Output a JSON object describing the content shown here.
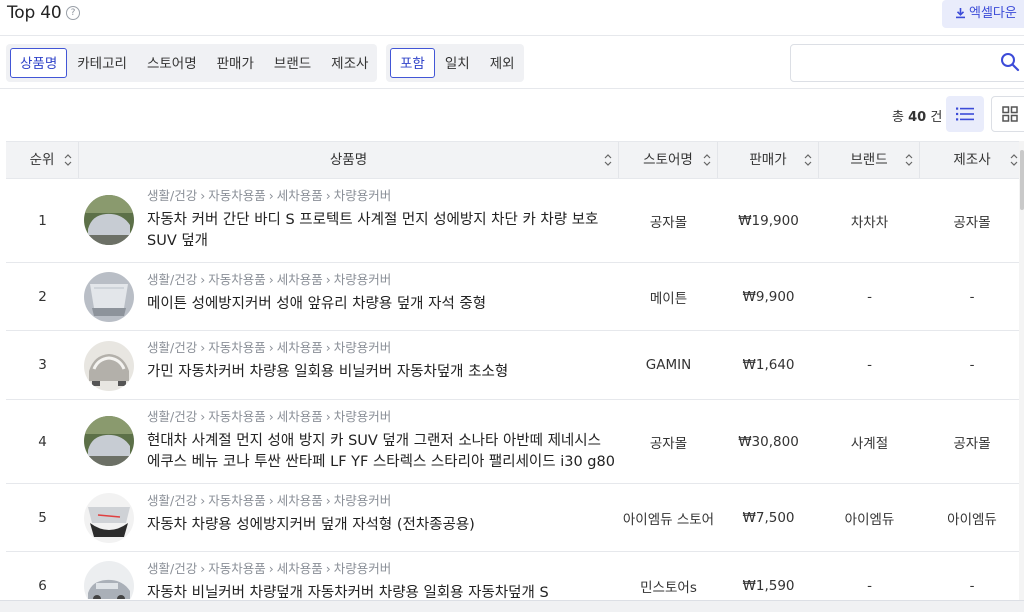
{
  "header": {
    "title": "Top 40",
    "help_glyph": "?",
    "excel_label": "엑셀다운"
  },
  "filters": {
    "field_tabs": [
      "상품명",
      "카테고리",
      "스토어명",
      "판매가",
      "브랜드",
      "제조사"
    ],
    "field_active": "상품명",
    "match_tabs": [
      "포함",
      "일치",
      "제외"
    ],
    "match_active": "포함",
    "search_value": "",
    "search_placeholder": ""
  },
  "summary": {
    "total_prefix": "총",
    "total_count": "40",
    "total_suffix": "건"
  },
  "table": {
    "columns": [
      "순위",
      "상품명",
      "스토어명",
      "판매가",
      "브랜드",
      "제조사"
    ],
    "rows": [
      {
        "rank": "1",
        "category": [
          "생활/건강",
          "자동차용품",
          "세차용품",
          "차량용커버"
        ],
        "name": "자동차 커버 간단 바디 S 프로텍트 사계절 먼지 성에방지 차단 카 차량 보호 SUV 덮개",
        "store": "공자몰",
        "price": "₩19,900",
        "brand": "차차차",
        "maker": "공자몰"
      },
      {
        "rank": "2",
        "category": [
          "생활/건강",
          "자동차용품",
          "세차용품",
          "차량용커버"
        ],
        "name": "메이튼 성에방지커버 성애 앞유리 차량용 덮개 자석 중형",
        "store": "메이튼",
        "price": "₩9,900",
        "brand": "-",
        "maker": "-"
      },
      {
        "rank": "3",
        "category": [
          "생활/건강",
          "자동차용품",
          "세차용품",
          "차량용커버"
        ],
        "name": "가민 자동차커버 차량용 일회용 비닐커버 자동차덮개 초소형",
        "store": "GAMIN",
        "price": "₩1,640",
        "brand": "-",
        "maker": "-"
      },
      {
        "rank": "4",
        "category": [
          "생활/건강",
          "자동차용품",
          "세차용품",
          "차량용커버"
        ],
        "name": "현대차 사계절 먼지 성애 방지 카 SUV 덮개 그랜저 소나타 아반떼 제네시스 에쿠스 베뉴 코나 투싼 싼타페 LF YF 스타렉스 스타리아 팰리세이드 i30 g80",
        "store": "공자몰",
        "price": "₩30,800",
        "brand": "사계절",
        "maker": "공자몰"
      },
      {
        "rank": "5",
        "category": [
          "생활/건강",
          "자동차용품",
          "세차용품",
          "차량용커버"
        ],
        "name": "자동차 차량용 성에방지커버 덮개 자석형 (전차종공용)",
        "store": "아이엠듀 스토어",
        "price": "₩7,500",
        "brand": "아이엠듀",
        "maker": "아이엠듀"
      },
      {
        "rank": "6",
        "category": [
          "생활/건강",
          "자동차용품",
          "세차용품",
          "차량용커버"
        ],
        "name": "자동차 비닐커버 차량덮개 자동차커버 차량용 일회용 자동차덮개 S",
        "store": "민스토어s",
        "price": "₩1,590",
        "brand": "-",
        "maker": "-"
      }
    ]
  },
  "colors": {
    "accent": "#3c4bd8",
    "accent_bg": "#e9ecfb",
    "header_bg": "#f2f3f5",
    "border": "#e6e8ec",
    "muted_text": "#8b9098"
  },
  "icons": {
    "help": "question-circle-icon",
    "excel": "download-icon",
    "search": "search-icon",
    "list_view": "list-view-icon",
    "grid_view": "grid-view-icon",
    "sort": "sort-arrows-icon",
    "breadcrumb_sep": "chevron-right-icon"
  }
}
